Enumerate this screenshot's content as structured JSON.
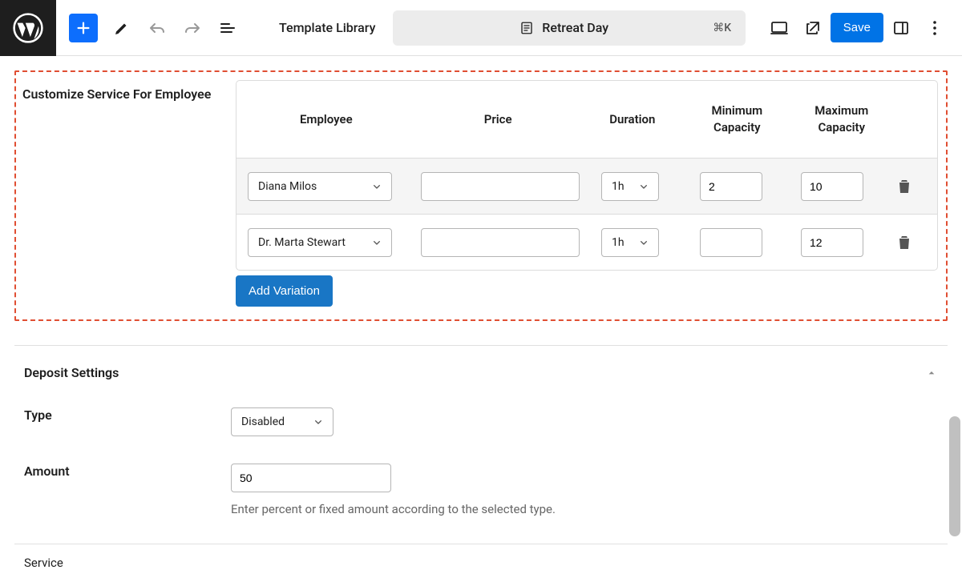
{
  "toolbar": {
    "template_library": "Template Library",
    "capsule_title": "Retreat Day",
    "capsule_shortcut": "⌘K",
    "save_label": "Save"
  },
  "dashed": {
    "title": "Customize Service For Employee",
    "columns": {
      "employee": "Employee",
      "price": "Price",
      "duration": "Duration",
      "min_cap": "Minimum Capacity",
      "max_cap": "Maximum Capacity"
    },
    "rows": [
      {
        "employee": "Diana Milos",
        "price": "",
        "duration": "1h",
        "min": "2",
        "max": "10"
      },
      {
        "employee": "Dr. Marta Stewart",
        "price": "",
        "duration": "1h",
        "min": "",
        "max": "12"
      }
    ],
    "add_variation_label": "Add Variation"
  },
  "deposit": {
    "section_title": "Deposit Settings",
    "type_label": "Type",
    "type_value": "Disabled",
    "amount_label": "Amount",
    "amount_value": "50",
    "amount_helper": "Enter percent or fixed amount according to the selected type."
  },
  "service_section": {
    "title": "Service"
  }
}
